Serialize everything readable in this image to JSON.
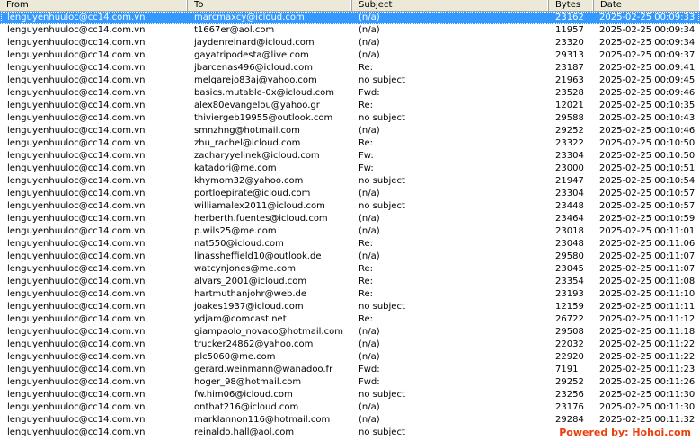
{
  "columns": {
    "from": "From",
    "to": "To",
    "subject": "Subject",
    "bytes": "Bytes",
    "date": "Date"
  },
  "rows": [
    {
      "from": "lenguyenhuuloc@cc14.com.vn",
      "to": "marcmaxcy@icloud.com",
      "subject": "(n/a)",
      "bytes": "23162",
      "date": "2025-02-25 00:09:33",
      "selected": true
    },
    {
      "from": "lenguyenhuuloc@cc14.com.vn",
      "to": "t1667er@aol.com",
      "subject": "(n/a)",
      "bytes": "11957",
      "date": "2025-02-25 00:09:34"
    },
    {
      "from": "lenguyenhuuloc@cc14.com.vn",
      "to": "jaydenreinard@icloud.com",
      "subject": "(n/a)",
      "bytes": "23320",
      "date": "2025-02-25 00:09:34"
    },
    {
      "from": "lenguyenhuuloc@cc14.com.vn",
      "to": "gayatripodesta@live.com",
      "subject": "(n/a)",
      "bytes": "29313",
      "date": "2025-02-25 00:09:37"
    },
    {
      "from": "lenguyenhuuloc@cc14.com.vn",
      "to": "jbarcenas496@icloud.com",
      "subject": "Re:",
      "bytes": "23187",
      "date": "2025-02-25 00:09:41"
    },
    {
      "from": "lenguyenhuuloc@cc14.com.vn",
      "to": "melgarejo83aj@yahoo.com",
      "subject": "no subject",
      "bytes": "21963",
      "date": "2025-02-25 00:09:45"
    },
    {
      "from": "lenguyenhuuloc@cc14.com.vn",
      "to": "basics.mutable-0x@icloud.com",
      "subject": "Fwd:",
      "bytes": "23528",
      "date": "2025-02-25 00:09:46"
    },
    {
      "from": "lenguyenhuuloc@cc14.com.vn",
      "to": "alex80evangelou@yahoo.gr",
      "subject": "Re:",
      "bytes": "12021",
      "date": "2025-02-25 00:10:35"
    },
    {
      "from": "lenguyenhuuloc@cc14.com.vn",
      "to": "thiviergeb19955@outlook.com",
      "subject": "no subject",
      "bytes": "29588",
      "date": "2025-02-25 00:10:43"
    },
    {
      "from": "lenguyenhuuloc@cc14.com.vn",
      "to": "smnzhng@hotmail.com",
      "subject": "(n/a)",
      "bytes": "29252",
      "date": "2025-02-25 00:10:46"
    },
    {
      "from": "lenguyenhuuloc@cc14.com.vn",
      "to": "zhu_rachel@icloud.com",
      "subject": "Re:",
      "bytes": "23322",
      "date": "2025-02-25 00:10:50"
    },
    {
      "from": "lenguyenhuuloc@cc14.com.vn",
      "to": "zacharyyelinek@icloud.com",
      "subject": "Fw:",
      "bytes": "23304",
      "date": "2025-02-25 00:10:50"
    },
    {
      "from": "lenguyenhuuloc@cc14.com.vn",
      "to": "katadori@me.com",
      "subject": "Fw:",
      "bytes": "23000",
      "date": "2025-02-25 00:10:51"
    },
    {
      "from": "lenguyenhuuloc@cc14.com.vn",
      "to": "khymom32@yahoo.com",
      "subject": "no subject",
      "bytes": "21947",
      "date": "2025-02-25 00:10:54"
    },
    {
      "from": "lenguyenhuuloc@cc14.com.vn",
      "to": "portloepirate@icloud.com",
      "subject": "(n/a)",
      "bytes": "23304",
      "date": "2025-02-25 00:10:57"
    },
    {
      "from": "lenguyenhuuloc@cc14.com.vn",
      "to": "williamalex2011@icloud.com",
      "subject": "no subject",
      "bytes": "23448",
      "date": "2025-02-25 00:10:57"
    },
    {
      "from": "lenguyenhuuloc@cc14.com.vn",
      "to": "herberth.fuentes@icloud.com",
      "subject": "(n/a)",
      "bytes": "23464",
      "date": "2025-02-25 00:10:59"
    },
    {
      "from": "lenguyenhuuloc@cc14.com.vn",
      "to": "p.wils25@me.com",
      "subject": "(n/a)",
      "bytes": "23018",
      "date": "2025-02-25 00:11:01"
    },
    {
      "from": "lenguyenhuuloc@cc14.com.vn",
      "to": "nat550@icloud.com",
      "subject": "Re:",
      "bytes": "23048",
      "date": "2025-02-25 00:11:06"
    },
    {
      "from": "lenguyenhuuloc@cc14.com.vn",
      "to": "linassheffield10@outlook.de",
      "subject": "(n/a)",
      "bytes": "29580",
      "date": "2025-02-25 00:11:07"
    },
    {
      "from": "lenguyenhuuloc@cc14.com.vn",
      "to": "watcynjones@me.com",
      "subject": "Re:",
      "bytes": "23045",
      "date": "2025-02-25 00:11:07"
    },
    {
      "from": "lenguyenhuuloc@cc14.com.vn",
      "to": "alvars_2001@icloud.com",
      "subject": "Re:",
      "bytes": "23354",
      "date": "2025-02-25 00:11:08"
    },
    {
      "from": "lenguyenhuuloc@cc14.com.vn",
      "to": "hartmuthanjohr@web.de",
      "subject": "Re:",
      "bytes": "23193",
      "date": "2025-02-25 00:11:10"
    },
    {
      "from": "lenguyenhuuloc@cc14.com.vn",
      "to": "joakes1937@icloud.com",
      "subject": "no subject",
      "bytes": "12159",
      "date": "2025-02-25 00:11:11"
    },
    {
      "from": "lenguyenhuuloc@cc14.com.vn",
      "to": "ydjam@comcast.net",
      "subject": "Re:",
      "bytes": "26722",
      "date": "2025-02-25 00:11:12"
    },
    {
      "from": "lenguyenhuuloc@cc14.com.vn",
      "to": "giampaolo_novaco@hotmail.com",
      "subject": "(n/a)",
      "bytes": "29508",
      "date": "2025-02-25 00:11:18"
    },
    {
      "from": "lenguyenhuuloc@cc14.com.vn",
      "to": "trucker24862@yahoo.com",
      "subject": "(n/a)",
      "bytes": "22032",
      "date": "2025-02-25 00:11:22"
    },
    {
      "from": "lenguyenhuuloc@cc14.com.vn",
      "to": "plc5060@me.com",
      "subject": "(n/a)",
      "bytes": "22920",
      "date": "2025-02-25 00:11:22"
    },
    {
      "from": "lenguyenhuuloc@cc14.com.vn",
      "to": "gerard.weinmann@wanadoo.fr",
      "subject": "Fwd:",
      "bytes": "7191",
      "date": "2025-02-25 00:11:23"
    },
    {
      "from": "lenguyenhuuloc@cc14.com.vn",
      "to": "hoger_98@hotmail.com",
      "subject": "Fwd:",
      "bytes": "29252",
      "date": "2025-02-25 00:11:26"
    },
    {
      "from": "lenguyenhuuloc@cc14.com.vn",
      "to": "fw.him06@icloud.com",
      "subject": "no subject",
      "bytes": "23256",
      "date": "2025-02-25 00:11:30"
    },
    {
      "from": "lenguyenhuuloc@cc14.com.vn",
      "to": "onthat216@icloud.com",
      "subject": "(n/a)",
      "bytes": "23176",
      "date": "2025-02-25 00:11:30"
    },
    {
      "from": "lenguyenhuuloc@cc14.com.vn",
      "to": "marklannon116@hotmail.com",
      "subject": "(n/a)",
      "bytes": "29284",
      "date": "2025-02-25 00:11:32"
    },
    {
      "from": "lenguyenhuuloc@cc14.com.vn",
      "to": "reinaldo.hall@aol.com",
      "subject": "no subject",
      "bytes": "",
      "date": ""
    }
  ],
  "watermark": "Powered by: Hohoi.com",
  "colors": {
    "selection": "#3399ff",
    "header_bg": "#ece9d8",
    "watermark": "#e8400c"
  }
}
